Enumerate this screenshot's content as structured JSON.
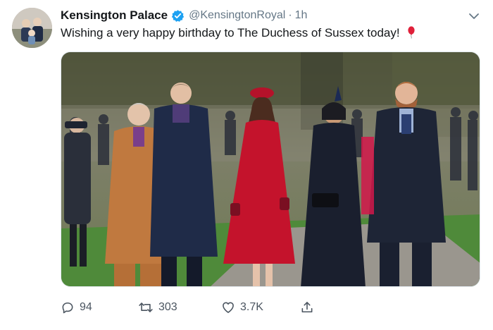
{
  "tweet": {
    "author_name": "Kensington Palace",
    "handle": "@KensingtonRoyal",
    "separator": "·",
    "time": "1h",
    "text": "Wishing a very happy birthday to The Duchess of Sussex today!"
  },
  "actions": {
    "reply_count": "94",
    "retweet_count": "303",
    "like_count": "3.7K"
  },
  "icons": {
    "verified": "verified-badge-icon",
    "caret": "chevron-down-icon",
    "emoji": "balloon-icon",
    "reply": "reply-icon",
    "retweet": "retweet-icon",
    "like": "heart-icon",
    "share": "share-icon"
  },
  "colors": {
    "verified_blue": "#1da1f2",
    "text_primary": "#14171a",
    "text_secondary": "#657786"
  }
}
